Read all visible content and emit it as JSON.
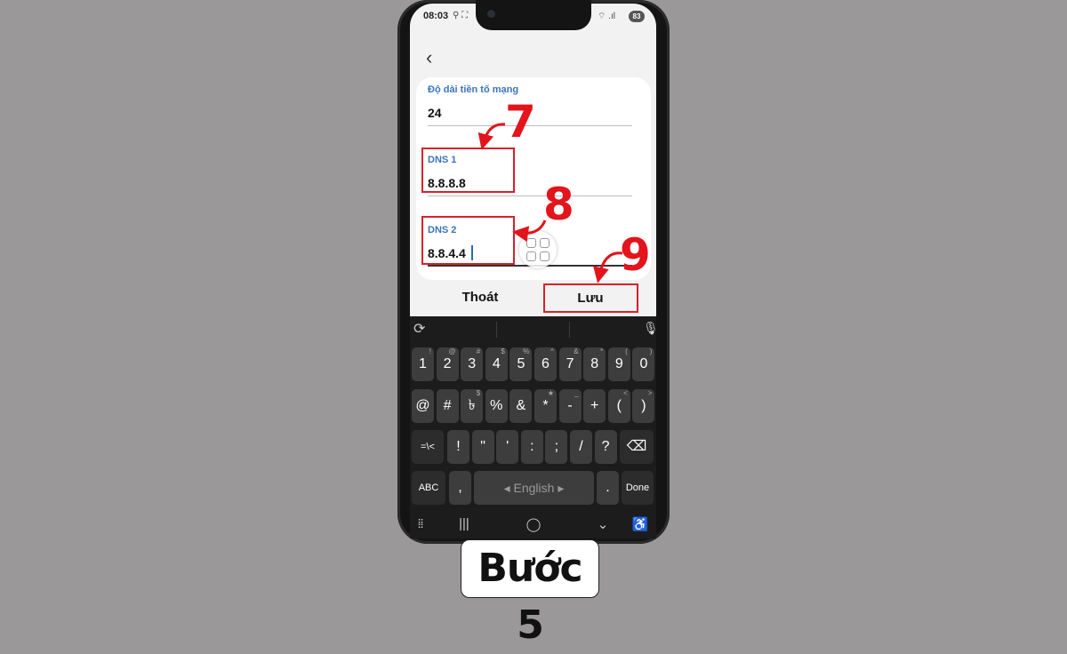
{
  "status": {
    "time": "08:03",
    "left_icons": "⚲ ⛶",
    "right_icons": "⌔ .ıl",
    "battery": "83"
  },
  "form": {
    "prefix_label": "Độ dài tiền tố mạng",
    "prefix_value": "24",
    "dns1_label": "DNS 1",
    "dns1_value": "8.8.8.8",
    "dns2_label": "DNS 2",
    "dns2_value": "8.8.4.4"
  },
  "actions": {
    "cancel": "Thoát",
    "save": "Lưu"
  },
  "steps": [
    "7",
    "8",
    "9"
  ],
  "keyboard": {
    "row1": [
      [
        "1",
        "!"
      ],
      [
        "2",
        "@"
      ],
      [
        "3",
        "#"
      ],
      [
        "4",
        "$"
      ],
      [
        "5",
        "%"
      ],
      [
        "6",
        "^"
      ],
      [
        "7",
        "&"
      ],
      [
        "8",
        "*"
      ],
      [
        "9",
        "("
      ],
      [
        "0",
        ")"
      ]
    ],
    "row2": [
      [
        "@",
        ""
      ],
      [
        "#",
        ""
      ],
      [
        "৳",
        "$"
      ],
      [
        "%",
        ""
      ],
      [
        "&",
        ""
      ],
      [
        "*",
        "★"
      ],
      [
        "-",
        "_"
      ],
      [
        "+",
        ""
      ],
      [
        "(",
        "<"
      ],
      [
        ")",
        ">"
      ]
    ],
    "row3": [
      "=\\<",
      "!",
      "\"",
      "'",
      ":",
      ";",
      "/",
      "?"
    ],
    "abc": "ABC",
    "comma": ",",
    "space": "English",
    "period": ".",
    "done": "Done"
  },
  "caption": "Bước 5",
  "colors": {
    "accent": "#3b74b8",
    "highlight": "#d8202a",
    "step_number": "#e3141b"
  }
}
